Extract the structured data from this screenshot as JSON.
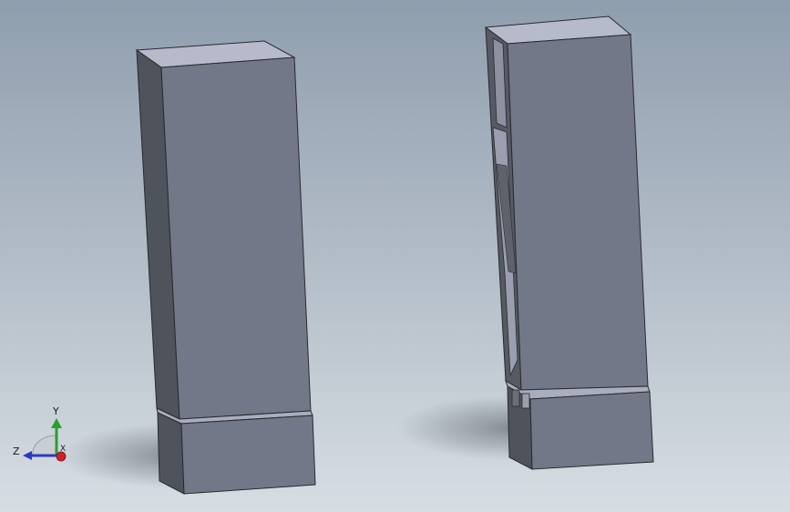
{
  "viewport": {
    "background": "gradient-gray-blue"
  },
  "parts": [
    {
      "name": "left-part",
      "color": "#737888"
    },
    {
      "name": "right-part",
      "color": "#737888"
    }
  ],
  "triad": {
    "labels": {
      "x": "X",
      "y": "Y",
      "z": "Z"
    },
    "colors": {
      "x": "#d0202a",
      "y": "#2a9e2f",
      "z": "#2a3bbf"
    }
  }
}
